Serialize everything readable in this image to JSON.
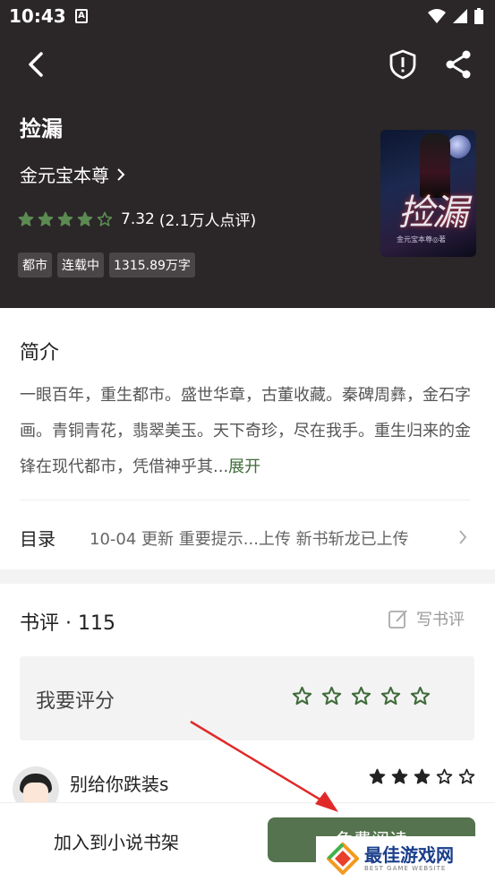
{
  "status_bar": {
    "time": "10:43",
    "notif_letter": "A"
  },
  "book": {
    "title": "捡漏",
    "author": "金元宝本尊",
    "rating": "7.32",
    "rating_count": "(2.1万人点评)",
    "star_filled_count": 4,
    "tags": [
      "都市",
      "连载中",
      "1315.89万字"
    ],
    "cover_title": "捡漏",
    "cover_author": "金元宝本尊◎著"
  },
  "intro": {
    "title": "简介",
    "text": "一眼百年，重生都市。盛世华章，古董收藏。秦碑周彝，金石字画。青铜青花，翡翠美玉。天下奇珍，尽在我手。重生归来的金锋在现代都市，凭借神乎其...",
    "expand_label": "展开"
  },
  "toc": {
    "label": "目录",
    "update": "10-04  更新  重要提示...上传 新书斩龙已上传"
  },
  "reviews": {
    "title": "书评 · 115",
    "write_label": "写书评",
    "rate_label": "我要评分",
    "first_comment": {
      "user": "别给你跌装s",
      "star_filled_count": 3
    }
  },
  "bottom": {
    "add_shelf": "加入到小说书架",
    "read_label": "免费阅读"
  },
  "watermark": {
    "main": "最佳游戏网",
    "sub": "BEST GAME WEBSITE"
  },
  "colors": {
    "header_bg": "#2b2628",
    "accent_green": "#54734e",
    "star_green": "#3f6b3a"
  }
}
